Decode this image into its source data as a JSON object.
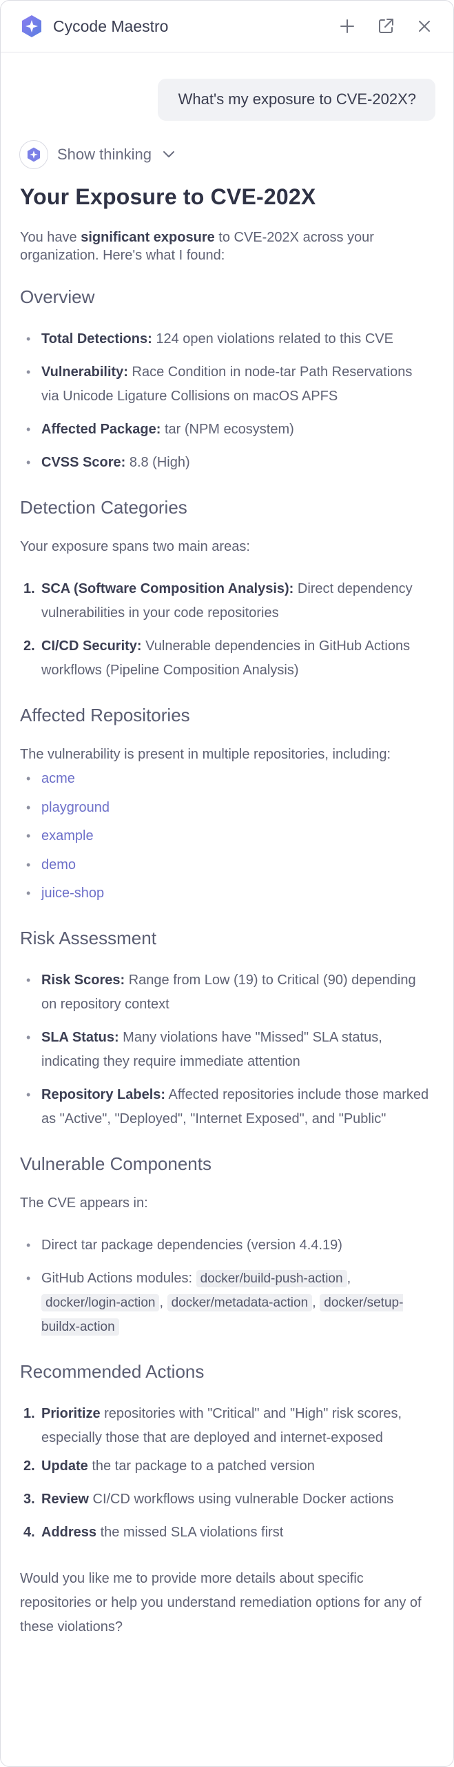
{
  "header": {
    "title": "Cycode Maestro"
  },
  "user_message": "What's my exposure to CVE-202X?",
  "thinking_label": "Show thinking",
  "response": {
    "title": "Your Exposure to CVE-202X",
    "intro": {
      "pre": "You have ",
      "bold": "significant exposure",
      "post": " to CVE-202X across your organization. Here's what I found:"
    },
    "overview": {
      "heading": "Overview",
      "items": [
        {
          "label": "Total Detections:",
          "text": " 124 open violations related to this CVE"
        },
        {
          "label": "Vulnerability:",
          "text": " Race Condition in node-tar Path Reservations via Unicode Ligature Collisions on macOS APFS"
        },
        {
          "label": "Affected Package:",
          "text": " tar (NPM ecosystem)"
        },
        {
          "label": "CVSS Score:",
          "text": " 8.8 (High)"
        }
      ]
    },
    "detection": {
      "heading": "Detection Categories",
      "intro": "Your exposure spans two main areas:",
      "items": [
        {
          "num": "1.",
          "label": "SCA (Software Composition Analysis):",
          "text": " Direct dependency vulnerabilities in your code repositories"
        },
        {
          "num": "2.",
          "label": "CI/CD Security:",
          "text": " Vulnerable dependencies in GitHub Actions workflows (Pipeline Composition Analysis)"
        }
      ]
    },
    "repos": {
      "heading": "Affected Repositories",
      "intro": "The vulnerability is present in multiple repositories, including:",
      "items": [
        "acme",
        "playground",
        "example",
        "demo",
        "juice-shop"
      ]
    },
    "risk": {
      "heading": "Risk Assessment",
      "items": [
        {
          "label": "Risk Scores:",
          "text": " Range from Low (19) to Critical (90) depending on repository context"
        },
        {
          "label": "SLA Status:",
          "text": " Many violations have \"Missed\" SLA status, indicating they require immediate attention"
        },
        {
          "label": "Repository Labels:",
          "text": " Affected repositories include those marked as \"Active\", \"Deployed\", \"Internet Exposed\", and \"Public\""
        }
      ]
    },
    "components": {
      "heading": "Vulnerable Components",
      "intro": "The CVE appears in:",
      "direct": "Direct tar package dependencies (version 4.4.19)",
      "actions_prefix": "GitHub Actions modules: ",
      "actions": [
        "docker/build-push-action",
        "docker/login-action",
        "docker/metadata-action",
        "docker/setup-buildx-action"
      ]
    },
    "actions": {
      "heading": "Recommended Actions",
      "items": [
        {
          "num": "1.",
          "label": "Prioritize",
          "text": " repositories with \"Critical\" and \"High\" risk scores, especially those that are deployed and internet-exposed"
        },
        {
          "num": "2.",
          "label": "Update",
          "text": " the tar package to a patched version"
        },
        {
          "num": "3.",
          "label": "Review",
          "text": " CI/CD workflows using vulnerable Docker actions"
        },
        {
          "num": "4.",
          "label": "Address",
          "text": " the missed SLA violations first"
        }
      ]
    },
    "closing": "Would you like me to provide more details about specific repositories or help you understand remediation options for any of these violations?"
  }
}
